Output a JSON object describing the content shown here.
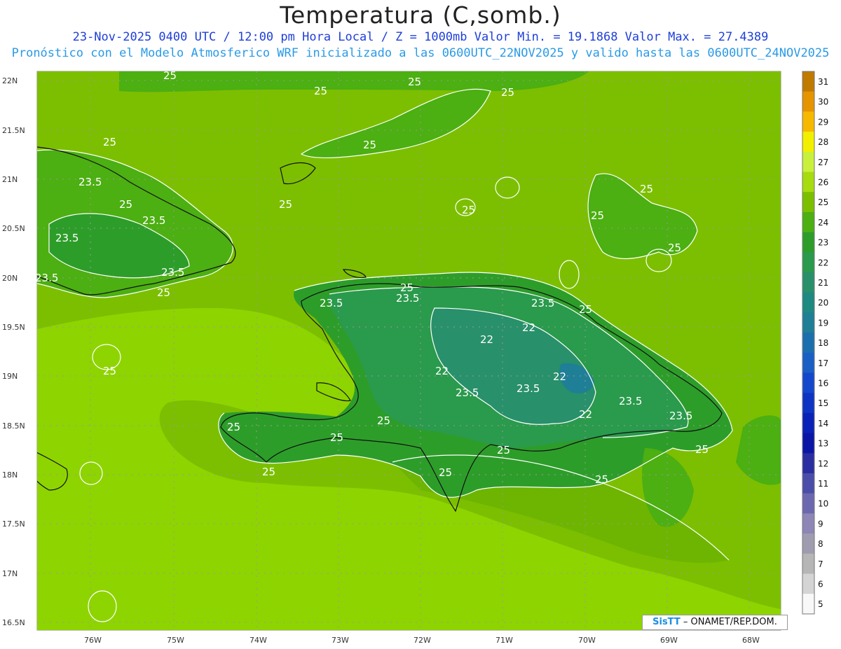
{
  "title": "Temperatura (C,somb.)",
  "subtitle_line1": "23-Nov-2025 0400 UTC / 12:00 pm Hora Local / Z = 1000mb  Valor Min. = 19.1868  Valor Max. = 27.4389",
  "subtitle_line2": "Pronóstico con el Modelo Atmosferico WRF inicializado a las 0600UTC_22NOV2025 y valido hasta las  0600UTC_24NOV2025",
  "credit": {
    "brand": "SisTT",
    "text": " – ONAMET/REP.DOM."
  },
  "axes": {
    "lat_labels": [
      "22N",
      "21.5N",
      "21N",
      "20.5N",
      "20N",
      "19.5N",
      "19N",
      "18.5N",
      "18N",
      "17.5N",
      "17N",
      "16.5N"
    ],
    "lon_labels": [
      "76W",
      "75W",
      "74W",
      "73W",
      "72W",
      "71W",
      "70W",
      "69W",
      "68W"
    ]
  },
  "colorbar": {
    "labels": [
      "31",
      "30",
      "29",
      "28",
      "27",
      "26",
      "25",
      "24",
      "23",
      "22",
      "21",
      "20",
      "19",
      "18",
      "17",
      "16",
      "15",
      "14",
      "13",
      "12",
      "11",
      "10",
      "9",
      "8",
      "7",
      "6",
      "5"
    ],
    "colors": [
      "#c07a00",
      "#e69400",
      "#f7b800",
      "#f2ef00",
      "#c8f03c",
      "#a6dc10",
      "#7cbf00",
      "#4caf12",
      "#2d9d2a",
      "#2a9a4c",
      "#28906a",
      "#1e8a82",
      "#1e7f96",
      "#1c6fae",
      "#1a5fc4",
      "#1448cc",
      "#0e34c4",
      "#0a22b8",
      "#0b16a6",
      "#2a2ea0",
      "#4a4ea8",
      "#6c68b0",
      "#8e86b6",
      "#a09cb0",
      "#b6b6b6",
      "#d4d4d4",
      "#f8f8f8"
    ]
  },
  "contour_labels": [
    {
      "text": "25"
    },
    {
      "text": "25"
    },
    {
      "text": "25"
    },
    {
      "text": "25"
    },
    {
      "text": "25"
    },
    {
      "text": "25"
    },
    {
      "text": "23.5"
    },
    {
      "text": "25"
    },
    {
      "text": "23.5"
    },
    {
      "text": "23.5"
    },
    {
      "text": "23.5"
    },
    {
      "text": "23.5"
    },
    {
      "text": "25"
    },
    {
      "text": "25"
    },
    {
      "text": "25"
    },
    {
      "text": "25"
    },
    {
      "text": "25"
    },
    {
      "text": "25"
    },
    {
      "text": "23.5"
    },
    {
      "text": "23.5"
    },
    {
      "text": "25"
    },
    {
      "text": "23.5"
    },
    {
      "text": "25"
    },
    {
      "text": "22"
    },
    {
      "text": "22"
    },
    {
      "text": "22"
    },
    {
      "text": "22"
    },
    {
      "text": "23.5"
    },
    {
      "text": "23.5"
    },
    {
      "text": "22"
    },
    {
      "text": "23.5"
    },
    {
      "text": "23.5"
    },
    {
      "text": "25"
    },
    {
      "text": "25"
    },
    {
      "text": "25"
    },
    {
      "text": "25"
    },
    {
      "text": "25"
    },
    {
      "text": "25"
    },
    {
      "text": "25"
    },
    {
      "text": "25"
    },
    {
      "text": "25"
    }
  ]
}
